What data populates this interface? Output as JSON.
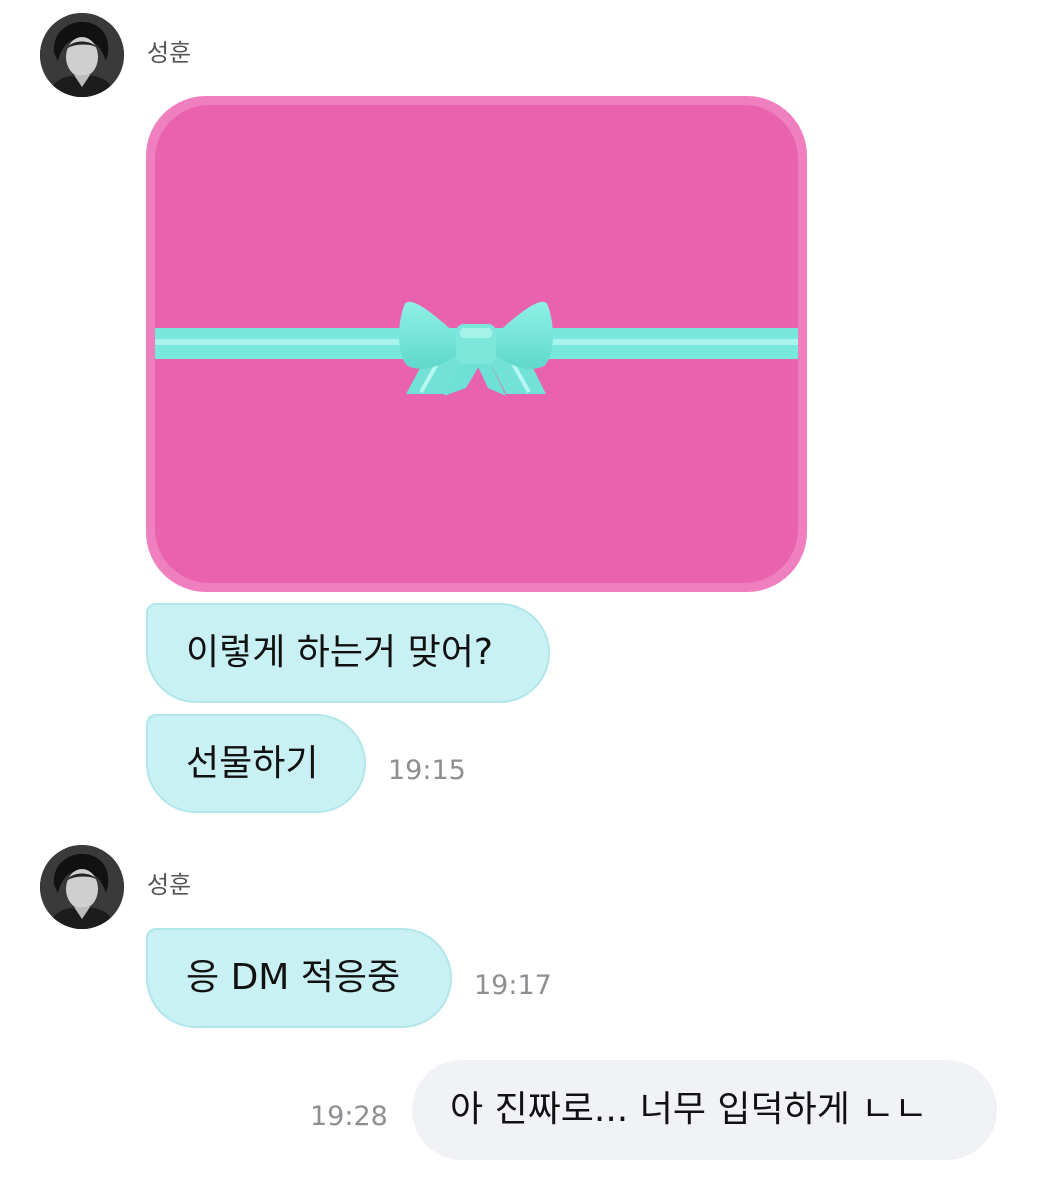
{
  "groups": [
    {
      "sender": "성훈",
      "avatar": "sender-portrait-avatar",
      "gift_card": {
        "icon": "gift-box-icon",
        "card_color": "#e962ad",
        "border_color": "#f07fc0",
        "ribbon_color": "#78e8dd"
      },
      "messages": [
        {
          "text": "이렇게 하는거 맞어?"
        },
        {
          "text": "선물하기",
          "time": "19:15"
        }
      ]
    },
    {
      "sender": "성훈",
      "avatar": "sender-portrait-avatar",
      "messages": [
        {
          "text": "응 DM 적응중",
          "time": "19:17"
        }
      ]
    }
  ],
  "outgoing": [
    {
      "text": "아 진짜로... 너무 입덕하게 ㄴㄴ",
      "time": "19:28"
    }
  ],
  "colors": {
    "incoming_bubble": "#c9f0f3",
    "outgoing_bubble": "#f1f2f6",
    "timestamp": "#8e8e93"
  }
}
